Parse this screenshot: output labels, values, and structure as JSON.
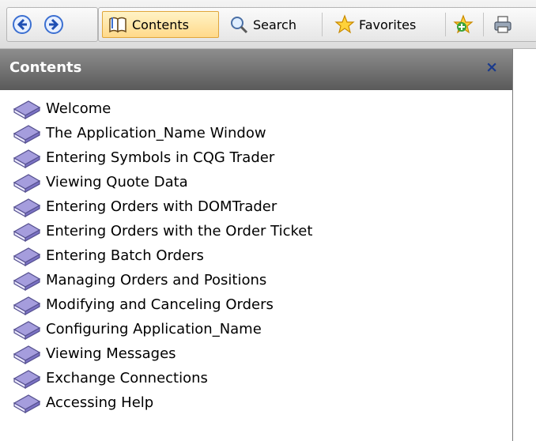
{
  "toolbar": {
    "back_icon": "back-arrow-icon",
    "forward_icon": "forward-arrow-icon",
    "contents_label": "Contents",
    "search_label": "Search",
    "favorites_label": "Favorites",
    "add_favorite_icon": "add-favorite-icon",
    "print_icon": "print-icon"
  },
  "panel": {
    "title": "Contents",
    "close_label": "×"
  },
  "toc": {
    "items": [
      {
        "label": "Welcome"
      },
      {
        "label": "The Application_Name Window"
      },
      {
        "label": "Entering Symbols in CQG Trader"
      },
      {
        "label": "Viewing Quote Data"
      },
      {
        "label": "Entering Orders with DOMTrader"
      },
      {
        "label": "Entering Orders with the Order Ticket"
      },
      {
        "label": "Entering Batch Orders"
      },
      {
        "label": "Managing Orders and Positions"
      },
      {
        "label": "Modifying and Canceling Orders"
      },
      {
        "label": "Configuring Application_Name"
      },
      {
        "label": "Viewing Messages"
      },
      {
        "label": "Exchange Connections"
      },
      {
        "label": "Accessing Help"
      }
    ]
  },
  "colors": {
    "active_tab": "#ffd98a",
    "header_bg": "#6e6e6e",
    "close_color": "#1a3a8c",
    "book_icon": "#8a82cf"
  }
}
